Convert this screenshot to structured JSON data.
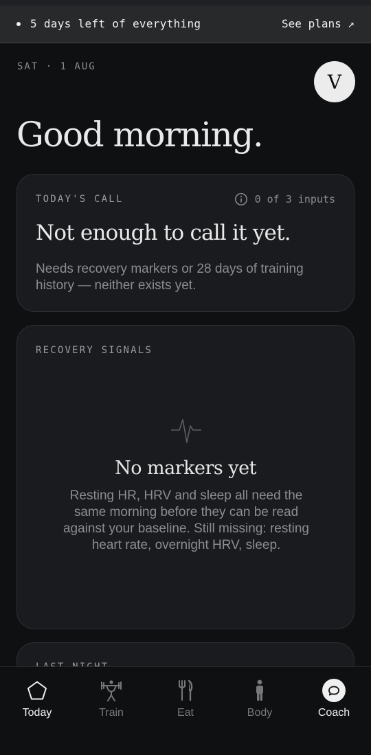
{
  "trial_banner": {
    "text": "5 days left of everything",
    "link_label": "See plans ↗"
  },
  "header": {
    "date": "SAT · 1 AUG",
    "avatar_initial": "V",
    "greeting": "Good morning."
  },
  "todays_call": {
    "label": "TODAY'S CALL",
    "inputs_status": "0 of 3 inputs",
    "title": "Not enough to call it yet.",
    "body": "Needs recovery markers or 28 days of training history — neither exists yet."
  },
  "recovery_signals": {
    "label": "RECOVERY SIGNALS",
    "icon": "heartbeat-pulse-icon",
    "empty_title": "No markers yet",
    "empty_body": "Resting HR, HRV and sleep all need the same morning before they can be read against your baseline. Still missing: resting heart rate, overnight HRV, sleep."
  },
  "last_night": {
    "label": "LAST NIGHT"
  },
  "tabs": [
    {
      "label": "Today",
      "icon": "pentagon-icon",
      "active": true
    },
    {
      "label": "Train",
      "icon": "weightlifter-icon",
      "active": false
    },
    {
      "label": "Eat",
      "icon": "fork-knife-icon",
      "active": false
    },
    {
      "label": "Body",
      "icon": "person-icon",
      "active": false
    },
    {
      "label": "Coach",
      "icon": "chat-bubble-icon",
      "active": false
    }
  ],
  "colors": {
    "background": "#0f1012",
    "card": "#1a1b1e",
    "banner": "#28292b",
    "muted_text": "#8c8d90",
    "active_tab": "#f2f2f2",
    "inactive_tab": "#77787b"
  }
}
